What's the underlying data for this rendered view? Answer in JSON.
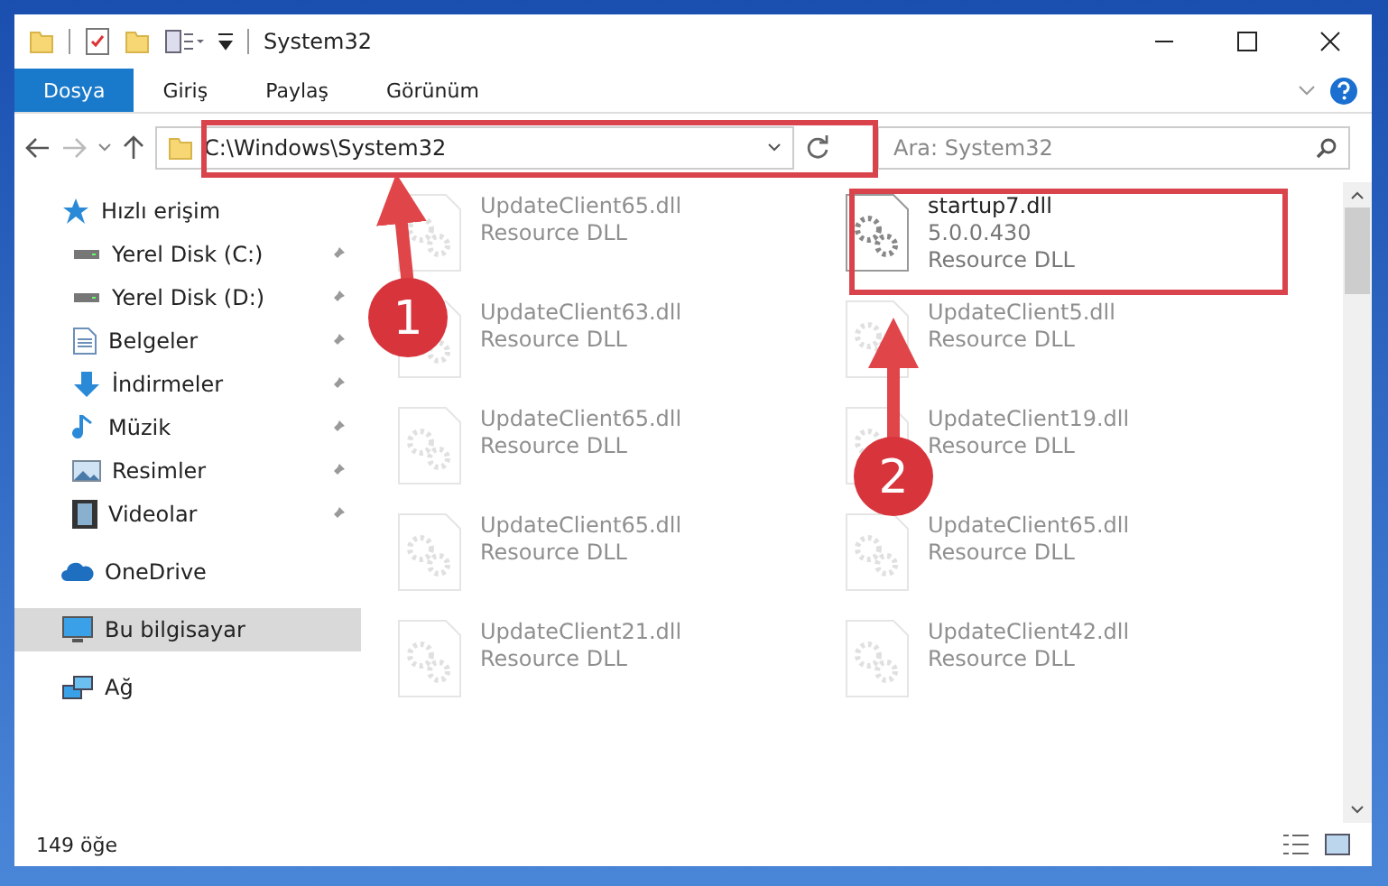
{
  "window": {
    "title": "System32"
  },
  "ribbon_tabs": [
    {
      "label": "Dosya",
      "selected": true
    },
    {
      "label": "Giriş",
      "selected": false
    },
    {
      "label": "Paylaş",
      "selected": false
    },
    {
      "label": "Görünüm",
      "selected": false
    }
  ],
  "address_bar": {
    "path": "C:\\Windows\\System32",
    "search_placeholder": "Ara: System32"
  },
  "sidebar": {
    "items": [
      {
        "label": "Hızlı erişim",
        "kind": "quick",
        "selected": false,
        "children": [
          {
            "label": "Yerel Disk (C:)",
            "kind": "drive"
          },
          {
            "label": "Yerel Disk (D:)",
            "kind": "drive"
          },
          {
            "label": "Belgeler",
            "kind": "docs"
          },
          {
            "label": "İndirmeler",
            "kind": "download"
          },
          {
            "label": "Müzik",
            "kind": "music"
          },
          {
            "label": "Resimler",
            "kind": "pictures"
          },
          {
            "label": "Videolar",
            "kind": "videos"
          }
        ]
      },
      {
        "label": "OneDrive",
        "kind": "cloud",
        "selected": false
      },
      {
        "label": "Bu bilgisayar",
        "kind": "computer",
        "selected": true
      },
      {
        "label": "Ağ",
        "kind": "network",
        "selected": false
      }
    ]
  },
  "files": [
    {
      "name": "UpdateClient65.dll",
      "type": "Resource DLL",
      "dimmed": true
    },
    {
      "name": "startup7.dll",
      "version": "5.0.0.430",
      "type": "Resource DLL",
      "dimmed": false
    },
    {
      "name": "UpdateClient63.dll",
      "type": "Resource DLL",
      "dimmed": true
    },
    {
      "name": "UpdateClient5.dll",
      "type": "Resource DLL",
      "dimmed": true
    },
    {
      "name": "UpdateClient65.dll",
      "type": "Resource DLL",
      "dimmed": true
    },
    {
      "name": "UpdateClient19.dll",
      "type": "Resource DLL",
      "dimmed": true
    },
    {
      "name": "UpdateClient65.dll",
      "type": "Resource DLL",
      "dimmed": true
    },
    {
      "name": "UpdateClient65.dll",
      "type": "Resource DLL",
      "dimmed": true
    },
    {
      "name": "UpdateClient21.dll",
      "type": "Resource DLL",
      "dimmed": true
    },
    {
      "name": "UpdateClient42.dll",
      "type": "Resource DLL",
      "dimmed": true
    }
  ],
  "status_bar": {
    "item_count": "149 öğe"
  },
  "annotations": [
    {
      "number": "1"
    },
    {
      "number": "2"
    }
  ]
}
